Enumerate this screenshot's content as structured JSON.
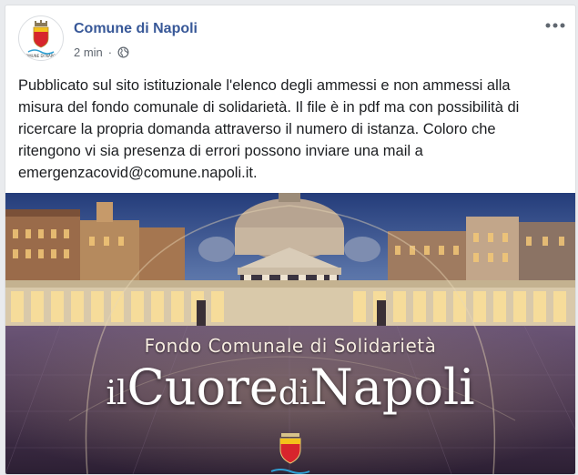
{
  "post": {
    "page_name": "Comune di Napoli",
    "avatar_caption": "COMUNE DI NAPOLI",
    "timestamp": "2 min",
    "separator": "·",
    "privacy_icon": "globe-icon",
    "more_icon": "more-options-icon",
    "text": "Pubblicato sul sito istituzionale l'elenco degli ammessi e non ammessi alla\nmisura del fondo comunale di solidarietà. Il file è in pdf ma con possibilità di\nricercare la propria domanda attraverso il numero di istanza. Coloro che\nritengono vi sia presenza di errori possono inviare una mail a\nemergenzacovid@comune.napoli.it."
  },
  "image": {
    "subtitle": "Fondo Comunale di Solidarietà",
    "title_part1": "il",
    "title_part2": "Cuore",
    "title_part3": "di",
    "title_part4": "Napoli"
  },
  "colors": {
    "page_name": "#385898",
    "text": "#1c1e21",
    "meta": "#606770",
    "background": "#e9ebee"
  }
}
